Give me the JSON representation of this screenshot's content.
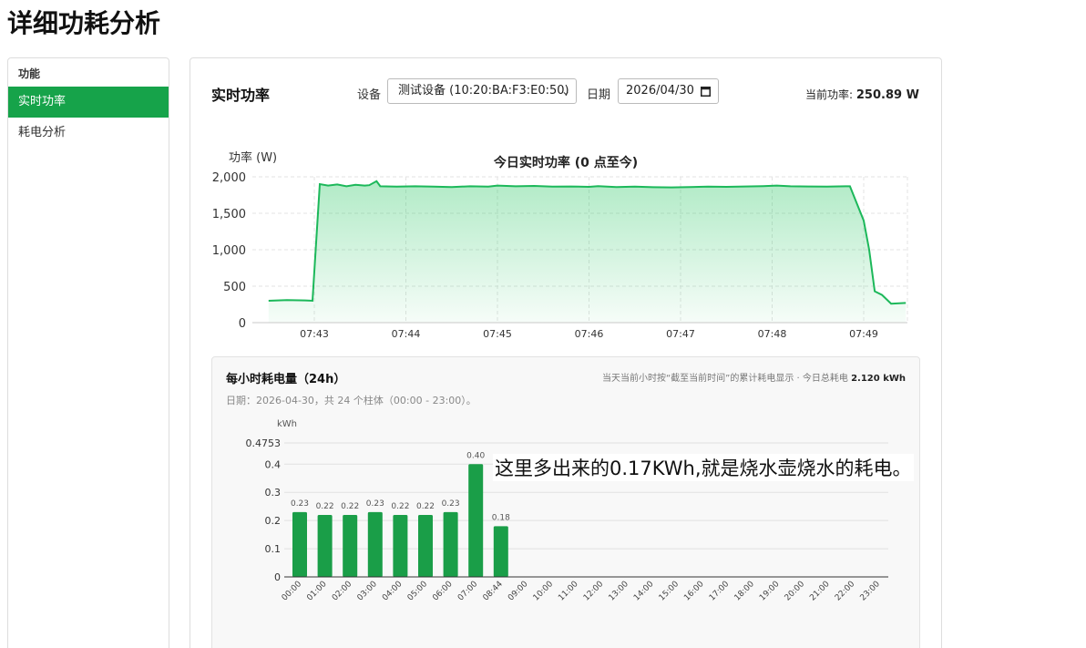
{
  "page": {
    "title": "详细功耗分析"
  },
  "sidebar": {
    "header": "功能",
    "items": [
      {
        "label": "实时功率",
        "active": true
      },
      {
        "label": "耗电分析",
        "active": false
      }
    ]
  },
  "realtime": {
    "title": "实时功率",
    "device_label": "设备",
    "device_value": "测试设备 (10:20:BA:F3:E0:50)",
    "date_label": "日期",
    "date_value": "2026/04/30",
    "current_power_label": "当前功率:",
    "current_power_value": "250.89 W"
  },
  "hourly": {
    "title": "每小时耗电量（24h）",
    "note_prefix": "当天当前小时按“截至当前时间”的累计耗电显示 · 今日总耗电",
    "note_total": "2.120 kWh",
    "subtitle": "日期：2026-04-30，共 24 个柱体（00:00 - 23:00）。"
  },
  "annotation": {
    "text": "这里多出来的0.17KWh,就是烧水壶烧水的耗电。"
  },
  "colors": {
    "accent": "#16a34a",
    "line": "#1cb85a",
    "bar": "#1a9e48"
  },
  "chart_data": [
    {
      "type": "area",
      "title": "今日实时功率 (0 点至今)",
      "ylabel": "功率 (W)",
      "ylim": [
        0,
        2000
      ],
      "yticks": [
        "0",
        "500",
        "1,000",
        "1,500",
        "2,000"
      ],
      "xticks": [
        "07:43",
        "07:44",
        "07:45",
        "07:46",
        "07:47",
        "07:48",
        "07:49"
      ],
      "x_range_min": [
        -0.5,
        6.46
      ],
      "series": [
        {
          "points": [
            [
              -0.5,
              300
            ],
            [
              -0.3,
              310
            ],
            [
              -0.1,
              305
            ],
            [
              -0.02,
              300
            ],
            [
              0.06,
              1900
            ],
            [
              0.15,
              1880
            ],
            [
              0.25,
              1895
            ],
            [
              0.35,
              1870
            ],
            [
              0.45,
              1890
            ],
            [
              0.55,
              1880
            ],
            [
              0.6,
              1885
            ],
            [
              0.68,
              1940
            ],
            [
              0.72,
              1870
            ],
            [
              0.9,
              1865
            ],
            [
              1.1,
              1870
            ],
            [
              1.3,
              1865
            ],
            [
              1.5,
              1860
            ],
            [
              1.7,
              1870
            ],
            [
              1.9,
              1865
            ],
            [
              2.0,
              1880
            ],
            [
              2.2,
              1870
            ],
            [
              2.4,
              1875
            ],
            [
              2.6,
              1865
            ],
            [
              2.8,
              1868
            ],
            [
              3.0,
              1862
            ],
            [
              3.1,
              1872
            ],
            [
              3.3,
              1860
            ],
            [
              3.5,
              1865
            ],
            [
              3.7,
              1858
            ],
            [
              3.9,
              1855
            ],
            [
              4.1,
              1860
            ],
            [
              4.3,
              1865
            ],
            [
              4.5,
              1862
            ],
            [
              4.7,
              1868
            ],
            [
              4.9,
              1872
            ],
            [
              5.05,
              1880
            ],
            [
              5.2,
              1870
            ],
            [
              5.4,
              1868
            ],
            [
              5.6,
              1865
            ],
            [
              5.8,
              1870
            ],
            [
              5.85,
              1870
            ],
            [
              6.0,
              1400
            ],
            [
              6.06,
              1000
            ],
            [
              6.12,
              430
            ],
            [
              6.2,
              380
            ],
            [
              6.3,
              260
            ],
            [
              6.46,
              270
            ]
          ]
        }
      ]
    },
    {
      "type": "bar",
      "unit_label": "kWh",
      "ylim": [
        0,
        0.4753
      ],
      "yticks": [
        "0",
        "0.1",
        "0.2",
        "0.3",
        "0.4",
        "0.4753"
      ],
      "categories": [
        "00:00",
        "01:00",
        "02:00",
        "03:00",
        "04:00",
        "05:00",
        "06:00",
        "07:00",
        "08:44",
        "09:00",
        "10:00",
        "11:00",
        "12:00",
        "13:00",
        "14:00",
        "15:00",
        "16:00",
        "17:00",
        "18:00",
        "19:00",
        "20:00",
        "21:00",
        "22:00",
        "23:00"
      ],
      "values": [
        0.23,
        0.22,
        0.22,
        0.23,
        0.22,
        0.22,
        0.23,
        0.4,
        0.18,
        null,
        null,
        null,
        null,
        null,
        null,
        null,
        null,
        null,
        null,
        null,
        null,
        null,
        null,
        null
      ],
      "data_labels": [
        "0.23",
        "0.22",
        "0.22",
        "0.23",
        "0.22",
        "0.22",
        "0.23",
        "0.40",
        "0.18"
      ]
    }
  ]
}
